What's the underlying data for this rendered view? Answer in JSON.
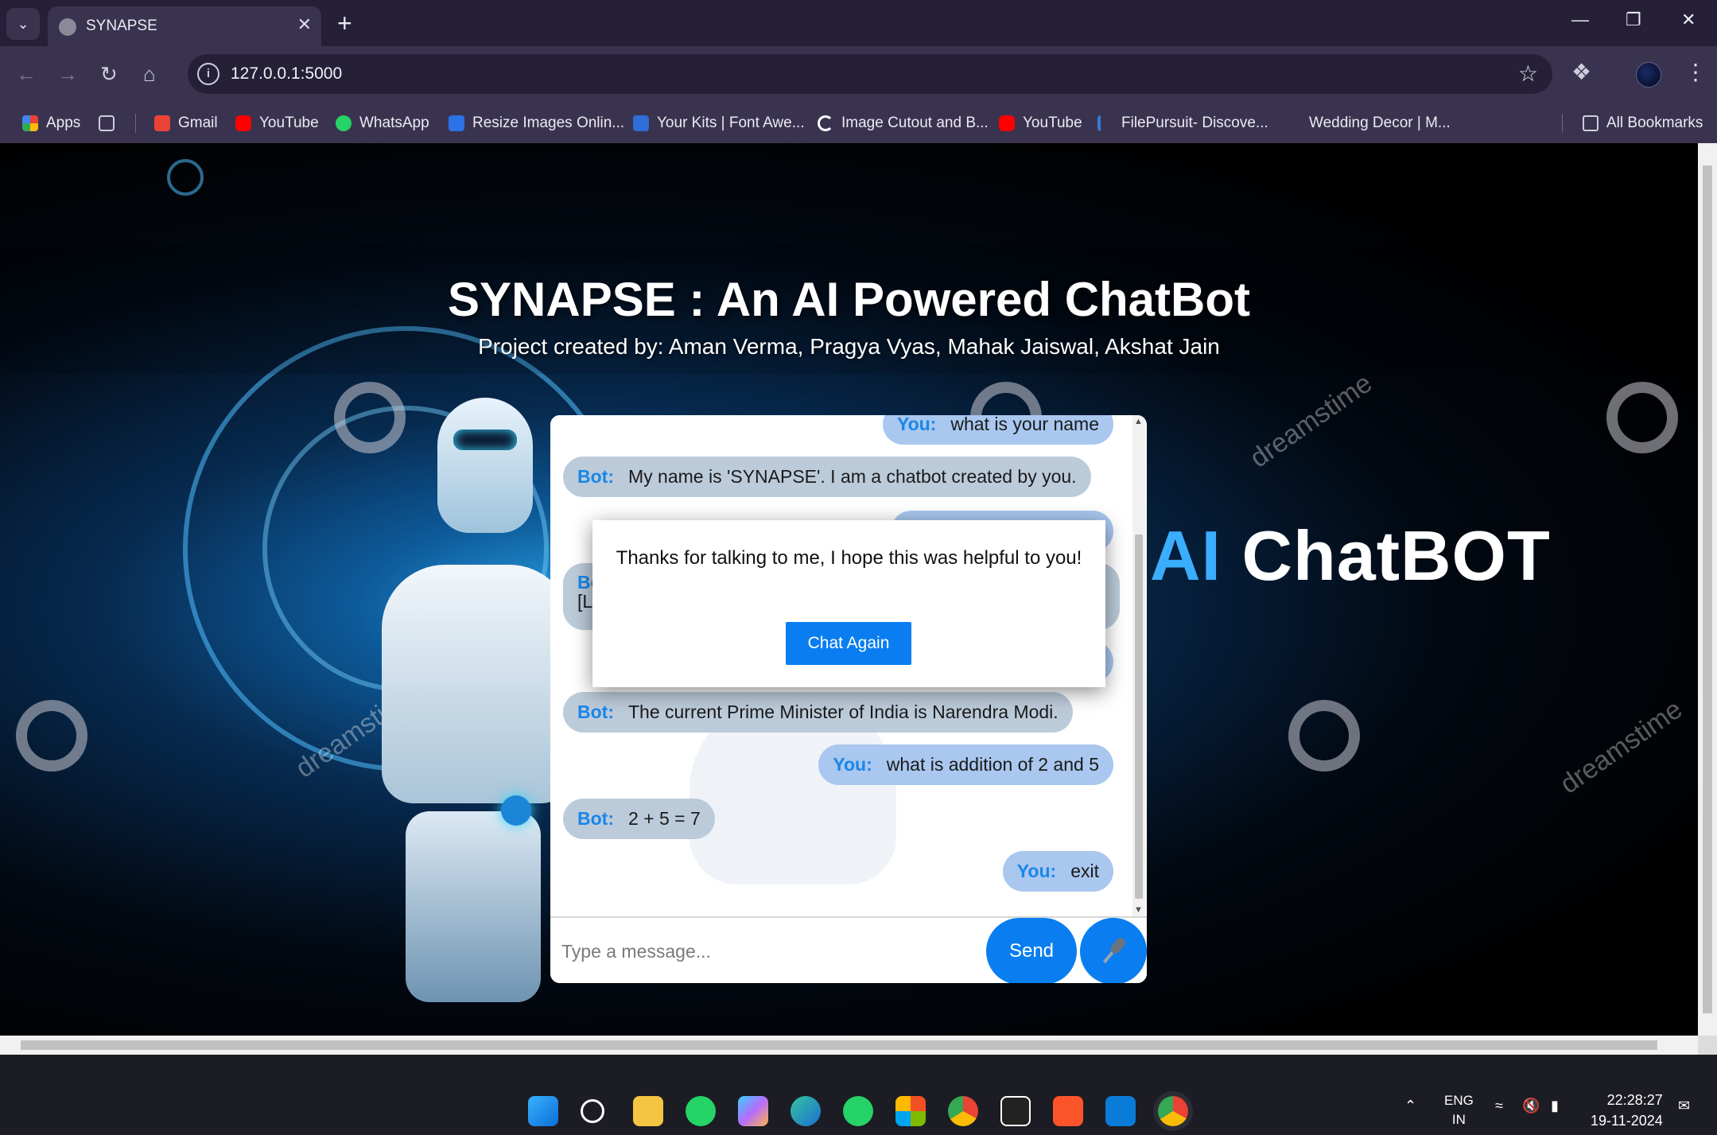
{
  "browser": {
    "tab_title": "SYNAPSE",
    "new_tab_symbol": "+",
    "url": "127.0.0.1:5000",
    "bookmarks": [
      {
        "label": "Apps",
        "icon": "apps-grid-icon",
        "color": "#e8453c"
      },
      {
        "label": "",
        "icon": "tab-groups-icon",
        "color": "#cfcddb"
      },
      {
        "label": "Gmail",
        "icon": "gmail-icon",
        "color": "#ea4335"
      },
      {
        "label": "YouTube",
        "icon": "youtube-icon",
        "color": "#ff0000"
      },
      {
        "label": "WhatsApp",
        "icon": "whatsapp-icon",
        "color": "#25d366"
      },
      {
        "label": "Resize Images Onlin...",
        "icon": "resize-icon",
        "color": "#2a72e6"
      },
      {
        "label": "Your Kits | Font Awe...",
        "icon": "font-awesome-icon",
        "color": "#2f6ed8"
      },
      {
        "label": "Image Cutout and B...",
        "icon": "cutout-icon",
        "color": "#ffffff"
      },
      {
        "label": "YouTube",
        "icon": "youtube-icon",
        "color": "#ff0000"
      },
      {
        "label": "FilePursuit- Discove...",
        "icon": "filepursuit-icon",
        "color": "#3a7bd5"
      },
      {
        "label": "Wedding Decor | M...",
        "icon": "",
        "color": ""
      },
      {
        "label": "All Bookmarks",
        "icon": "folder-icon",
        "color": "#cfcddb"
      }
    ]
  },
  "page": {
    "title": "SYNAPSE : An AI Powered ChatBot",
    "subtitle": "Project created by: Aman Verma, Pragya Vyas, Mahak Jaiswal, Akshat Jain",
    "background_text_ai": "AI",
    "background_text_chatbot": "ChatBOT",
    "watermark": "dreamstime"
  },
  "chat": {
    "messages": [
      {
        "role": "user",
        "who": "You:",
        "text": "what is your name"
      },
      {
        "role": "bot",
        "who": "Bot:",
        "text": "My name is 'SYNAPSE'. I am a chatbot created by you."
      },
      {
        "role": "bot",
        "who": "Bot:",
        "text": "The current Prime Minister of India is Narendra Modi."
      },
      {
        "role": "user",
        "who": "You:",
        "text": "what is addition of 2 and 5"
      },
      {
        "role": "bot",
        "who": "Bot:",
        "text": "2 + 5 = 7"
      },
      {
        "role": "user",
        "who": "You:",
        "text": "exit"
      }
    ],
    "partial_bot_prefix": "Bo",
    "partial_bot_line2": "[L",
    "input_placeholder": "Type a message...",
    "send_label": "Send"
  },
  "modal": {
    "message": "Thanks for talking to me, I hope this was helpful to you!",
    "button_label": "Chat Again"
  },
  "taskbar": {
    "language": "ENG",
    "region": "IN",
    "time": "22:28:27",
    "date": "19-11-2024"
  }
}
